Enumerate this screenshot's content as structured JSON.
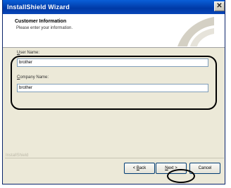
{
  "window": {
    "title": "InstallShield Wizard",
    "close_glyph": "✕"
  },
  "header": {
    "title": "Customer Information",
    "subtitle": "Please enter your information."
  },
  "form": {
    "user_name": {
      "label_prefix": "",
      "label_key": "U",
      "label_rest": "ser Name:",
      "value": "brother"
    },
    "company_name": {
      "label_prefix": "",
      "label_key": "C",
      "label_rest": "ompany Name:",
      "value": "brother"
    }
  },
  "footer": {
    "brand": "InstallShield"
  },
  "buttons": {
    "back": {
      "label_prefix": "< ",
      "label_key": "B",
      "label_rest": "ack"
    },
    "next": {
      "label_prefix": "",
      "label_key": "N",
      "label_rest": "ext >"
    },
    "cancel": {
      "label": "Cancel"
    }
  },
  "colors": {
    "title_bar": "#0a5fd8",
    "dialog_face": "#ece9d8",
    "field_border": "#7f9db9",
    "annotation": "#000000"
  },
  "icons": {
    "close": "close-icon",
    "header_graphic": "wizard-swoosh-icon"
  }
}
